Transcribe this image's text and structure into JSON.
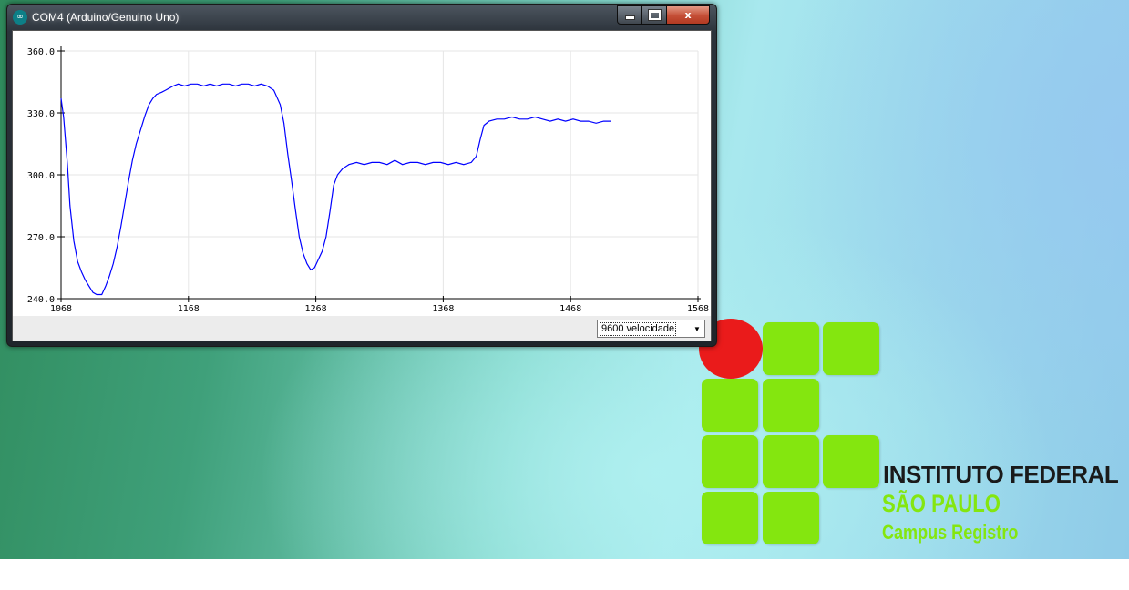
{
  "window": {
    "title": "COM4 (Arduino/Genuino Uno)",
    "icon": "arduino-icon",
    "buttons": {
      "minimize_icon": "minimize-icon",
      "maximize_icon": "maximize-icon",
      "close_glyph": "x"
    }
  },
  "chart_data": {
    "type": "line",
    "xlim": [
      1068,
      1568
    ],
    "ylim": [
      240.0,
      360.0
    ],
    "x_ticks": [
      "1068",
      "1168",
      "1268",
      "1368",
      "1468",
      "1568"
    ],
    "y_ticks": [
      "240.0",
      "270.0",
      "300.0",
      "330.0",
      "360.0"
    ],
    "grid": true,
    "series": [
      {
        "color": "#0000ff",
        "points": [
          [
            1068,
            337
          ],
          [
            1070,
            328
          ],
          [
            1073,
            305
          ],
          [
            1075,
            285
          ],
          [
            1078,
            268
          ],
          [
            1081,
            258
          ],
          [
            1084,
            253
          ],
          [
            1087,
            249
          ],
          [
            1090,
            246
          ],
          [
            1093,
            243
          ],
          [
            1096,
            242
          ],
          [
            1100,
            242
          ],
          [
            1103,
            246
          ],
          [
            1106,
            251
          ],
          [
            1109,
            257
          ],
          [
            1112,
            265
          ],
          [
            1115,
            275
          ],
          [
            1118,
            286
          ],
          [
            1121,
            297
          ],
          [
            1124,
            307
          ],
          [
            1127,
            315
          ],
          [
            1131,
            323
          ],
          [
            1134,
            329
          ],
          [
            1137,
            334
          ],
          [
            1140,
            337
          ],
          [
            1143,
            339
          ],
          [
            1147,
            340
          ],
          [
            1150,
            341
          ],
          [
            1153,
            342
          ],
          [
            1156,
            343
          ],
          [
            1160,
            344
          ],
          [
            1165,
            343
          ],
          [
            1170,
            344
          ],
          [
            1175,
            344
          ],
          [
            1180,
            343
          ],
          [
            1185,
            344
          ],
          [
            1190,
            343
          ],
          [
            1195,
            344
          ],
          [
            1200,
            344
          ],
          [
            1205,
            343
          ],
          [
            1210,
            344
          ],
          [
            1215,
            344
          ],
          [
            1220,
            343
          ],
          [
            1225,
            344
          ],
          [
            1230,
            343
          ],
          [
            1235,
            341
          ],
          [
            1240,
            334
          ],
          [
            1243,
            325
          ],
          [
            1246,
            310
          ],
          [
            1249,
            297
          ],
          [
            1252,
            283
          ],
          [
            1255,
            270
          ],
          [
            1258,
            262
          ],
          [
            1261,
            257
          ],
          [
            1264,
            254
          ],
          [
            1267,
            255
          ],
          [
            1270,
            259
          ],
          [
            1273,
            263
          ],
          [
            1276,
            270
          ],
          [
            1279,
            282
          ],
          [
            1282,
            295
          ],
          [
            1285,
            300
          ],
          [
            1289,
            303
          ],
          [
            1294,
            305
          ],
          [
            1300,
            306
          ],
          [
            1306,
            305
          ],
          [
            1312,
            306
          ],
          [
            1318,
            306
          ],
          [
            1324,
            305
          ],
          [
            1330,
            307
          ],
          [
            1336,
            305
          ],
          [
            1342,
            306
          ],
          [
            1348,
            306
          ],
          [
            1354,
            305
          ],
          [
            1360,
            306
          ],
          [
            1366,
            306
          ],
          [
            1372,
            305
          ],
          [
            1378,
            306
          ],
          [
            1384,
            305
          ],
          [
            1390,
            306
          ],
          [
            1394,
            309
          ],
          [
            1397,
            317
          ],
          [
            1400,
            324
          ],
          [
            1404,
            326
          ],
          [
            1410,
            327
          ],
          [
            1416,
            327
          ],
          [
            1422,
            328
          ],
          [
            1428,
            327
          ],
          [
            1434,
            327
          ],
          [
            1440,
            328
          ],
          [
            1446,
            327
          ],
          [
            1452,
            326
          ],
          [
            1458,
            327
          ],
          [
            1464,
            326
          ],
          [
            1470,
            327
          ],
          [
            1476,
            326
          ],
          [
            1482,
            326
          ],
          [
            1488,
            325
          ],
          [
            1494,
            326
          ],
          [
            1500,
            326
          ]
        ]
      }
    ]
  },
  "statusbar": {
    "baud": "9600 velocidade"
  },
  "logo": {
    "line1": "INSTITUTO FEDERAL",
    "line2": "SÃO PAULO",
    "line3": "Campus Registro",
    "colors": {
      "red": "#ea1b1b",
      "green": "#84e60f",
      "text": "#1a1a1a"
    }
  }
}
